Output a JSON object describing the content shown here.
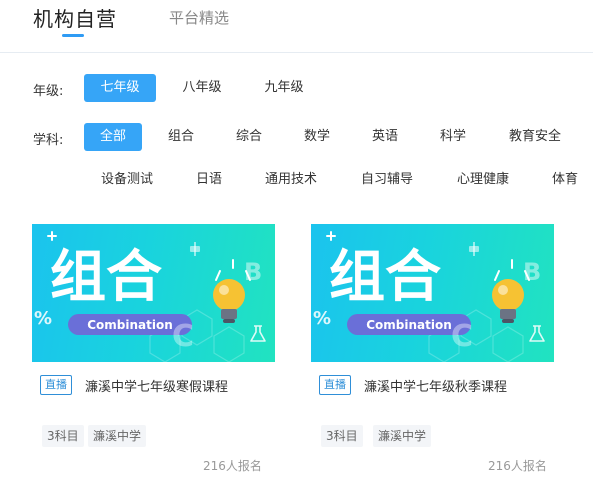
{
  "tabs": {
    "active": "机构自营",
    "other": "平台精选"
  },
  "filters": {
    "grade": {
      "label": "年级:",
      "options": [
        "七年级",
        "八年级",
        "九年级"
      ],
      "selected": "七年级"
    },
    "subject": {
      "label": "学科:",
      "options": [
        "全部",
        "组合",
        "综合",
        "数学",
        "英语",
        "科学",
        "教育安全",
        "设备测试",
        "日语",
        "通用技术",
        "自习辅导",
        "心理健康",
        "体育"
      ],
      "selected": "全部"
    }
  },
  "thumbnail": {
    "title": "组合",
    "subtitle": "Combination",
    "letter_b": "B",
    "letter_c": "C",
    "percent": "%"
  },
  "courses": [
    {
      "badge": "直播",
      "title": "濂溪中学七年级寒假课程",
      "tags": [
        "3科目",
        "濂溪中学"
      ],
      "enrolled": "216人报名"
    },
    {
      "badge": "直播",
      "title": "濂溪中学七年级秋季课程",
      "tags": [
        "3科目",
        "濂溪中学"
      ],
      "enrolled": "216人报名"
    }
  ],
  "colors": {
    "accent": "#36a5f7",
    "badge": "#2f8fd8",
    "thumb_start": "#1bc3ee",
    "thumb_end": "#21e3c0",
    "pill": "#6a6fd8"
  }
}
